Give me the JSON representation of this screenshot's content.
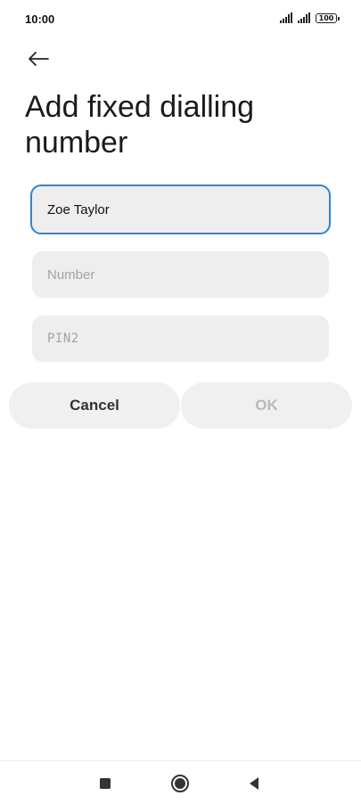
{
  "status_bar": {
    "time": "10:00",
    "battery": "100"
  },
  "header": {
    "back_icon": "arrow-left-icon",
    "title": "Add fixed dialling number"
  },
  "form": {
    "name": {
      "value": "Zoe Taylor",
      "placeholder": ""
    },
    "number": {
      "value": "",
      "placeholder": "Number"
    },
    "pin2": {
      "value": "",
      "placeholder": "PIN2"
    }
  },
  "actions": {
    "cancel_label": "Cancel",
    "ok_label": "OK"
  },
  "nav": {
    "recents_icon": "square-icon",
    "home_icon": "circle-icon",
    "back_icon": "triangle-back-icon"
  },
  "colors": {
    "accent": "#2c86d6",
    "field_bg": "#eeeeee",
    "button_bg": "#f0f0f0",
    "disabled_text": "#b9b9b9"
  }
}
